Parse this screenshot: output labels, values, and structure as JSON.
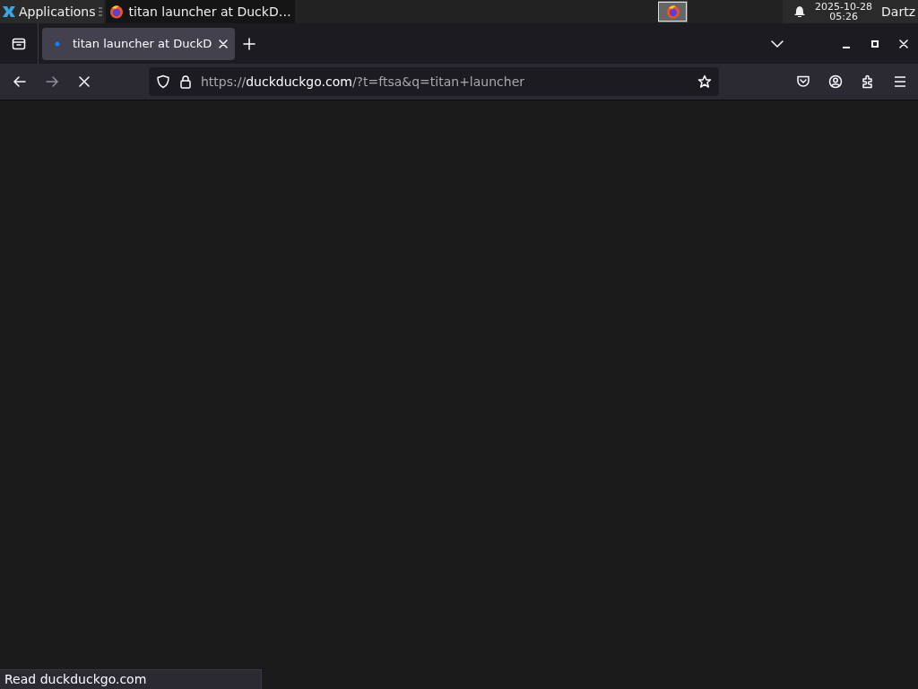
{
  "panel": {
    "apps_label": "Applications",
    "window_button": {
      "title": "titan launcher at DuckD…",
      "selected": false
    },
    "workspaces": [
      {
        "selected": true
      }
    ],
    "clock": {
      "date": "2025-10-28",
      "time": "05:26"
    },
    "user": "Dartz"
  },
  "tabs": [
    {
      "title": "titan launcher at DuckD",
      "selected": true
    }
  ],
  "nav": {
    "back_disabled": false,
    "forward_disabled": true
  },
  "address": {
    "prefix": "https://",
    "host": "duckduckgo.com",
    "rest": "/?t=ftsa&q=titan+launcher"
  },
  "status_bar": "Read duckduckgo.com"
}
